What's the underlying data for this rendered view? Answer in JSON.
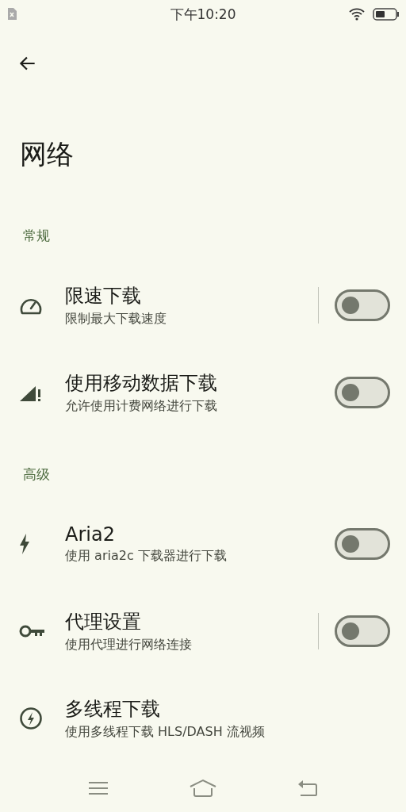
{
  "status_bar": {
    "time": "下午10:20"
  },
  "title": "网络",
  "sections": [
    {
      "header": "常规",
      "items": [
        {
          "title": "限速下载",
          "subtitle": "限制最大下载速度",
          "kind": "switch",
          "divider": true,
          "on": false
        },
        {
          "title": "使用移动数据下载",
          "subtitle": "允许使用计费网络进行下载",
          "kind": "switch",
          "divider": false,
          "on": false
        }
      ]
    },
    {
      "header": "高级",
      "items": [
        {
          "title": "Aria2",
          "subtitle": "使用 aria2c 下载器进行下载",
          "kind": "switch",
          "divider": false,
          "on": false
        },
        {
          "title": "代理设置",
          "subtitle": "使用代理进行网络连接",
          "kind": "switch",
          "divider": true,
          "on": false
        },
        {
          "title": "多线程下载",
          "subtitle": "使用多线程下载 HLS/DASH 流视频",
          "kind": "plain"
        }
      ]
    }
  ]
}
